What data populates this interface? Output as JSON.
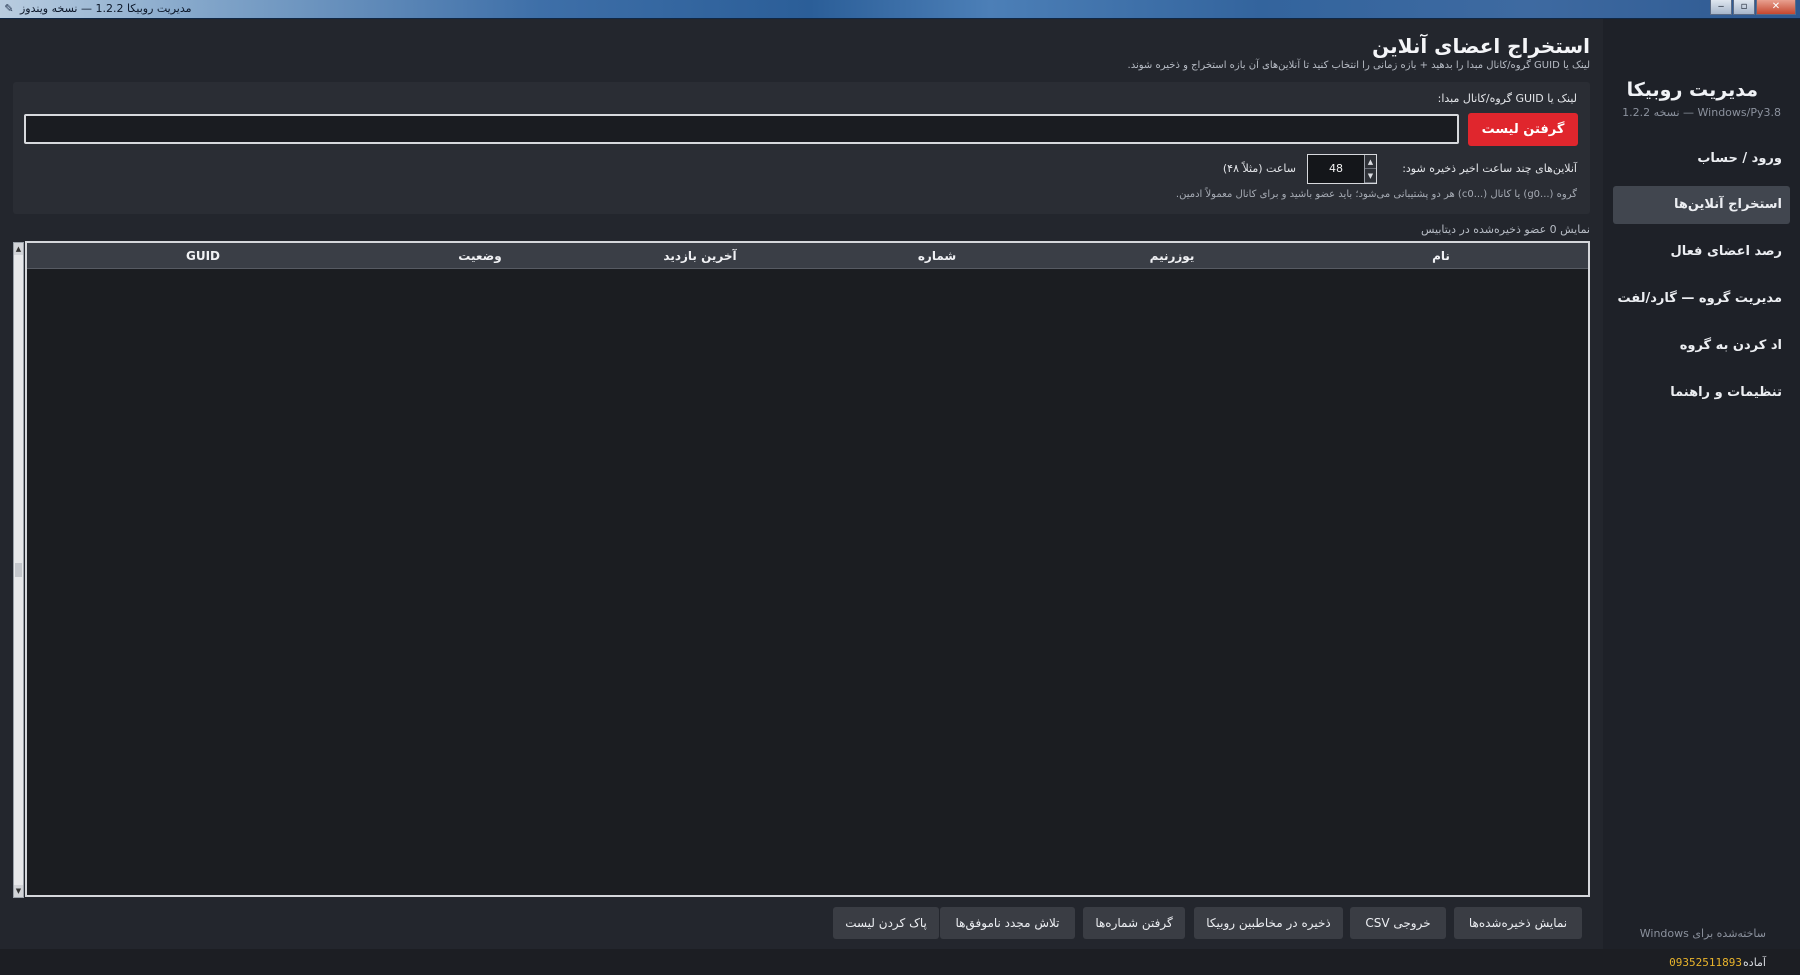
{
  "window": {
    "title": "مدیریت روبیکا 1.2.2 — نسخه ویندوز",
    "controls": {
      "minimize": "‒",
      "maximize": "▫",
      "close": "✕"
    }
  },
  "sidebar": {
    "title": "مدیریت روبیکا",
    "subtitle": "1.2.2 نسخه — Windows/Py3.8",
    "items": [
      {
        "label": "ورود / حساب",
        "active": false
      },
      {
        "label": "استخراج آنلاین‌ها",
        "active": true
      },
      {
        "label": "رصد اعضای فعال",
        "active": false
      },
      {
        "label": "مدیریت گروه — گارد/لفت",
        "active": false
      },
      {
        "label": "اد کردن به گروه",
        "active": false
      },
      {
        "label": "تنظیمات و راهنما",
        "active": false
      }
    ],
    "footer": "Windows ساخته‌شده برای"
  },
  "header": {
    "title": "استخراج اعضای آنلاین",
    "description": ".گروه/کانال مبدا را بدهید + بازه زمانی را انتخاب کنید تا آنلاین‌های آن بازه استخراج و ذخیره شوند GUID لینک یا"
  },
  "form": {
    "source_label": ":گروه/کانال مبدا GUID لینک یا",
    "source_value": "",
    "fetch_button": "گرفتن لیست",
    "hours_label": ":آنلاین‌های چند ساعت اخیر ذخیره شود",
    "hours_value": "48",
    "hours_hint": "(ساعت (مثلاً ۴۸",
    "note": ".هر دو پشتیبانی می‌شود؛ باید عضو باشید و برای کانال معمولاً ادمین (c0...) یا کانال (g0...) گروه"
  },
  "table": {
    "record_count_text": "نمایش 0 عضو ذخیره‌شده در دیتابیس",
    "columns": [
      "نام",
      "یوزرنیم",
      "شماره",
      "آخرین بازدید",
      "وضعیت",
      "GUID"
    ],
    "rows": []
  },
  "actions": {
    "show_saved": "نمایش ذخیره‌شده‌ها",
    "export_csv": "CSV خروجی",
    "save_contacts": "ذخیره در مخاطبین روبیکا",
    "get_numbers": "گرفتن شماره‌ها",
    "retry_failed": "تلاش مجدد ناموفق‌ها",
    "clear_list": "پاک کردن لیست"
  },
  "status": {
    "ready": "آماده",
    "phone": "09352511893"
  },
  "colors": {
    "accent_red": "#e0262d",
    "status_phone": "#e9b42c",
    "background": "#23262d"
  }
}
